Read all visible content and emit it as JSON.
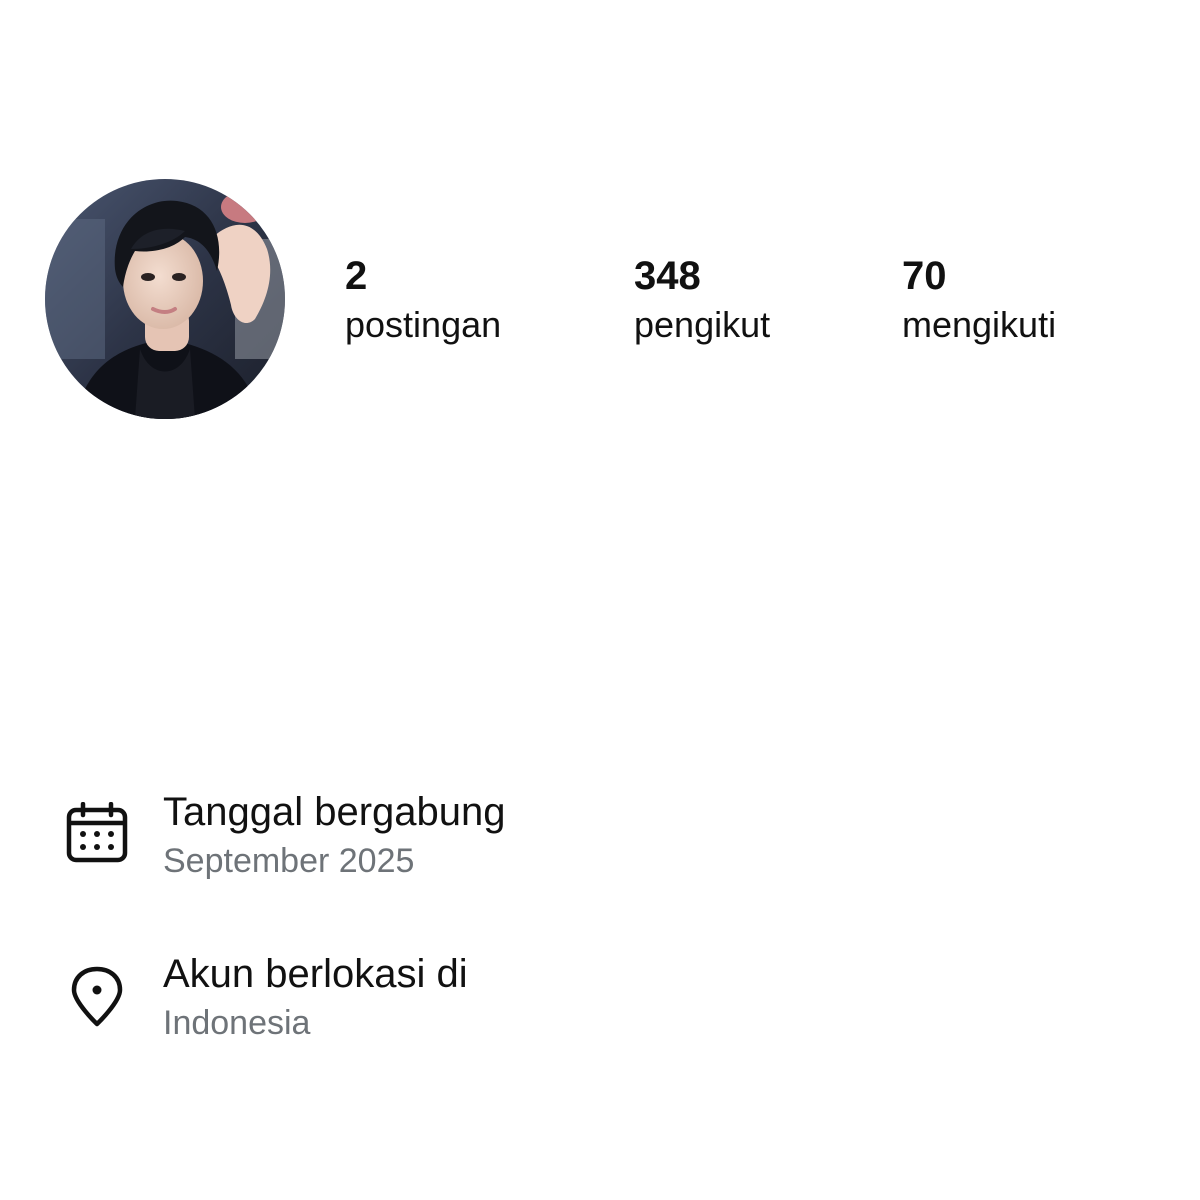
{
  "profile": {
    "avatar_alt": "profile photo",
    "stats": {
      "posts": {
        "value": "2",
        "label": "postingan"
      },
      "followers": {
        "value": "348",
        "label": "pengikut"
      },
      "following": {
        "value": "70",
        "label": "mengikuti"
      }
    }
  },
  "about": {
    "joined": {
      "icon": "calendar-icon",
      "title": "Tanggal bergabung",
      "value": "September 2025"
    },
    "location": {
      "icon": "location-pin-icon",
      "title": "Akun berlokasi di",
      "value": "Indonesia"
    }
  },
  "colors": {
    "text_primary": "#111111",
    "text_secondary": "#6e7378",
    "background": "#ffffff"
  }
}
